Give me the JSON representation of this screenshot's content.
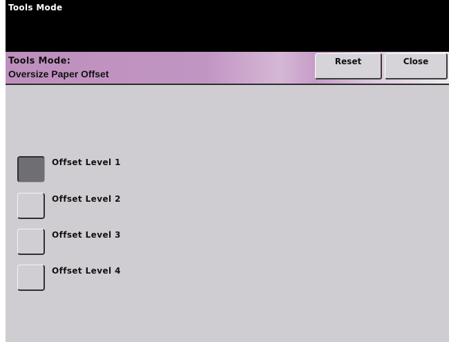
{
  "top_bar": {
    "title": "Tools Mode"
  },
  "header": {
    "line1": "Tools Mode:",
    "line2": "Oversize Paper Offset",
    "reset_label": "Reset",
    "close_label": "Close"
  },
  "options": [
    {
      "label": "Offset Level 1",
      "selected": true
    },
    {
      "label": "Offset Level 2",
      "selected": false
    },
    {
      "label": "Offset Level 3",
      "selected": false
    },
    {
      "label": "Offset Level 4",
      "selected": false
    }
  ],
  "colors": {
    "header_gradient_start": "#bd8fbd",
    "header_gradient_end": "#ecebec",
    "panel_bg": "#cfcdd1",
    "selected_fill": "#6f6f73"
  }
}
